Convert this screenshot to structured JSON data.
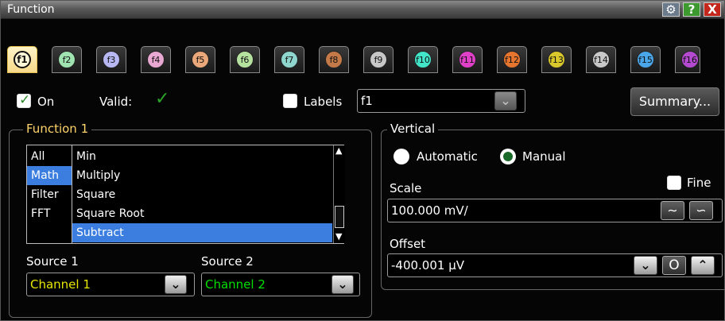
{
  "window": {
    "title": "Function"
  },
  "titlebar_buttons": {
    "settings": "gear-icon",
    "help": "?",
    "close": "X"
  },
  "tabs": [
    {
      "label": "f1",
      "color": "#fff8d8"
    },
    {
      "label": "f2",
      "color": "#9fe3b0"
    },
    {
      "label": "f3",
      "color": "#b8b8f2"
    },
    {
      "label": "f4",
      "color": "#e9a8d2"
    },
    {
      "label": "f5",
      "color": "#e9a77a"
    },
    {
      "label": "f6",
      "color": "#b6e2a0"
    },
    {
      "label": "f7",
      "color": "#8fd6cf"
    },
    {
      "label": "f8",
      "color": "#c47a48"
    },
    {
      "label": "f9",
      "color": "#c8c8c8"
    },
    {
      "label": "f10",
      "color": "#43e5c8"
    },
    {
      "label": "f11",
      "color": "#e040c8"
    },
    {
      "label": "f12",
      "color": "#e6752f"
    },
    {
      "label": "f13",
      "color": "#d9c82c"
    },
    {
      "label": "f14",
      "color": "#c8c8c8"
    },
    {
      "label": "f15",
      "color": "#4aa6e8"
    },
    {
      "label": "f16",
      "color": "#b44ad0"
    }
  ],
  "header_row": {
    "on_label": "On",
    "valid_label": "Valid:",
    "valid_mark": "✓",
    "labels_label": "Labels",
    "labels_value": "f1",
    "summary_button": "Summary..."
  },
  "function_group": {
    "legend": "Function 1",
    "categories": [
      "All",
      "Math",
      "Filter",
      "FFT"
    ],
    "selected_category": "Math",
    "operators": [
      "Min",
      "Multiply",
      "Square",
      "Square Root",
      "Subtract"
    ],
    "selected_operator": "Subtract",
    "source1_label": "Source 1",
    "source1_value": "Channel 1",
    "source2_label": "Source 2",
    "source2_value": "Channel 2"
  },
  "vertical_group": {
    "legend": "Vertical",
    "automatic_label": "Automatic",
    "manual_label": "Manual",
    "mode": "Manual",
    "scale_label": "Scale",
    "fine_label": "Fine",
    "scale_value": "100.000 mV/",
    "offset_label": "Offset",
    "offset_value": "-400.001 µV"
  },
  "colors": {
    "source1": "#e6e600",
    "source2": "#00e000",
    "selection": "#3b7ee0"
  }
}
